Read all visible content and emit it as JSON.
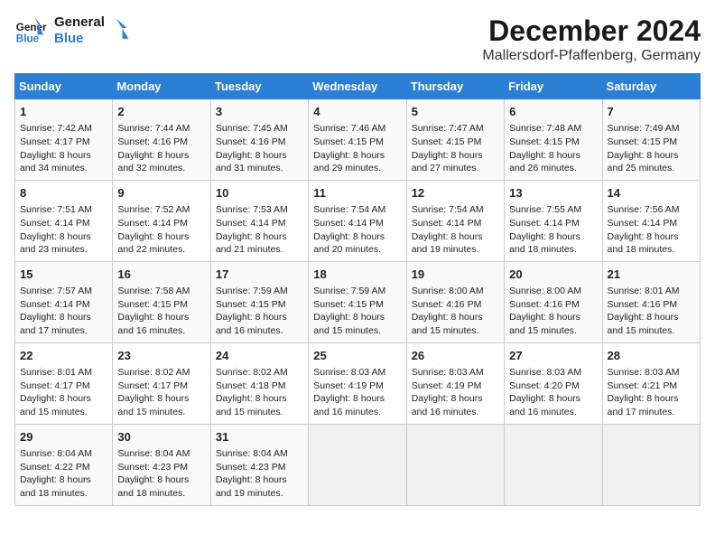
{
  "header": {
    "logo_line1": "General",
    "logo_line2": "Blue",
    "month_title": "December 2024",
    "location": "Mallersdorf-Pfaffenberg, Germany"
  },
  "weekdays": [
    "Sunday",
    "Monday",
    "Tuesday",
    "Wednesday",
    "Thursday",
    "Friday",
    "Saturday"
  ],
  "weeks": [
    [
      {
        "day": "1",
        "info": "Sunrise: 7:42 AM\nSunset: 4:17 PM\nDaylight: 8 hours\nand 34 minutes."
      },
      {
        "day": "2",
        "info": "Sunrise: 7:44 AM\nSunset: 4:16 PM\nDaylight: 8 hours\nand 32 minutes."
      },
      {
        "day": "3",
        "info": "Sunrise: 7:45 AM\nSunset: 4:16 PM\nDaylight: 8 hours\nand 31 minutes."
      },
      {
        "day": "4",
        "info": "Sunrise: 7:46 AM\nSunset: 4:15 PM\nDaylight: 8 hours\nand 29 minutes."
      },
      {
        "day": "5",
        "info": "Sunrise: 7:47 AM\nSunset: 4:15 PM\nDaylight: 8 hours\nand 27 minutes."
      },
      {
        "day": "6",
        "info": "Sunrise: 7:48 AM\nSunset: 4:15 PM\nDaylight: 8 hours\nand 26 minutes."
      },
      {
        "day": "7",
        "info": "Sunrise: 7:49 AM\nSunset: 4:15 PM\nDaylight: 8 hours\nand 25 minutes."
      }
    ],
    [
      {
        "day": "8",
        "info": "Sunrise: 7:51 AM\nSunset: 4:14 PM\nDaylight: 8 hours\nand 23 minutes."
      },
      {
        "day": "9",
        "info": "Sunrise: 7:52 AM\nSunset: 4:14 PM\nDaylight: 8 hours\nand 22 minutes."
      },
      {
        "day": "10",
        "info": "Sunrise: 7:53 AM\nSunset: 4:14 PM\nDaylight: 8 hours\nand 21 minutes."
      },
      {
        "day": "11",
        "info": "Sunrise: 7:54 AM\nSunset: 4:14 PM\nDaylight: 8 hours\nand 20 minutes."
      },
      {
        "day": "12",
        "info": "Sunrise: 7:54 AM\nSunset: 4:14 PM\nDaylight: 8 hours\nand 19 minutes."
      },
      {
        "day": "13",
        "info": "Sunrise: 7:55 AM\nSunset: 4:14 PM\nDaylight: 8 hours\nand 18 minutes."
      },
      {
        "day": "14",
        "info": "Sunrise: 7:56 AM\nSunset: 4:14 PM\nDaylight: 8 hours\nand 18 minutes."
      }
    ],
    [
      {
        "day": "15",
        "info": "Sunrise: 7:57 AM\nSunset: 4:14 PM\nDaylight: 8 hours\nand 17 minutes."
      },
      {
        "day": "16",
        "info": "Sunrise: 7:58 AM\nSunset: 4:15 PM\nDaylight: 8 hours\nand 16 minutes."
      },
      {
        "day": "17",
        "info": "Sunrise: 7:59 AM\nSunset: 4:15 PM\nDaylight: 8 hours\nand 16 minutes."
      },
      {
        "day": "18",
        "info": "Sunrise: 7:59 AM\nSunset: 4:15 PM\nDaylight: 8 hours\nand 15 minutes."
      },
      {
        "day": "19",
        "info": "Sunrise: 8:00 AM\nSunset: 4:16 PM\nDaylight: 8 hours\nand 15 minutes."
      },
      {
        "day": "20",
        "info": "Sunrise: 8:00 AM\nSunset: 4:16 PM\nDaylight: 8 hours\nand 15 minutes."
      },
      {
        "day": "21",
        "info": "Sunrise: 8:01 AM\nSunset: 4:16 PM\nDaylight: 8 hours\nand 15 minutes."
      }
    ],
    [
      {
        "day": "22",
        "info": "Sunrise: 8:01 AM\nSunset: 4:17 PM\nDaylight: 8 hours\nand 15 minutes."
      },
      {
        "day": "23",
        "info": "Sunrise: 8:02 AM\nSunset: 4:17 PM\nDaylight: 8 hours\nand 15 minutes."
      },
      {
        "day": "24",
        "info": "Sunrise: 8:02 AM\nSunset: 4:18 PM\nDaylight: 8 hours\nand 15 minutes."
      },
      {
        "day": "25",
        "info": "Sunrise: 8:03 AM\nSunset: 4:19 PM\nDaylight: 8 hours\nand 16 minutes."
      },
      {
        "day": "26",
        "info": "Sunrise: 8:03 AM\nSunset: 4:19 PM\nDaylight: 8 hours\nand 16 minutes."
      },
      {
        "day": "27",
        "info": "Sunrise: 8:03 AM\nSunset: 4:20 PM\nDaylight: 8 hours\nand 16 minutes."
      },
      {
        "day": "28",
        "info": "Sunrise: 8:03 AM\nSunset: 4:21 PM\nDaylight: 8 hours\nand 17 minutes."
      }
    ],
    [
      {
        "day": "29",
        "info": "Sunrise: 8:04 AM\nSunset: 4:22 PM\nDaylight: 8 hours\nand 18 minutes."
      },
      {
        "day": "30",
        "info": "Sunrise: 8:04 AM\nSunset: 4:23 PM\nDaylight: 8 hours\nand 18 minutes."
      },
      {
        "day": "31",
        "info": "Sunrise: 8:04 AM\nSunset: 4:23 PM\nDaylight: 8 hours\nand 19 minutes."
      },
      {
        "day": "",
        "info": ""
      },
      {
        "day": "",
        "info": ""
      },
      {
        "day": "",
        "info": ""
      },
      {
        "day": "",
        "info": ""
      }
    ]
  ]
}
